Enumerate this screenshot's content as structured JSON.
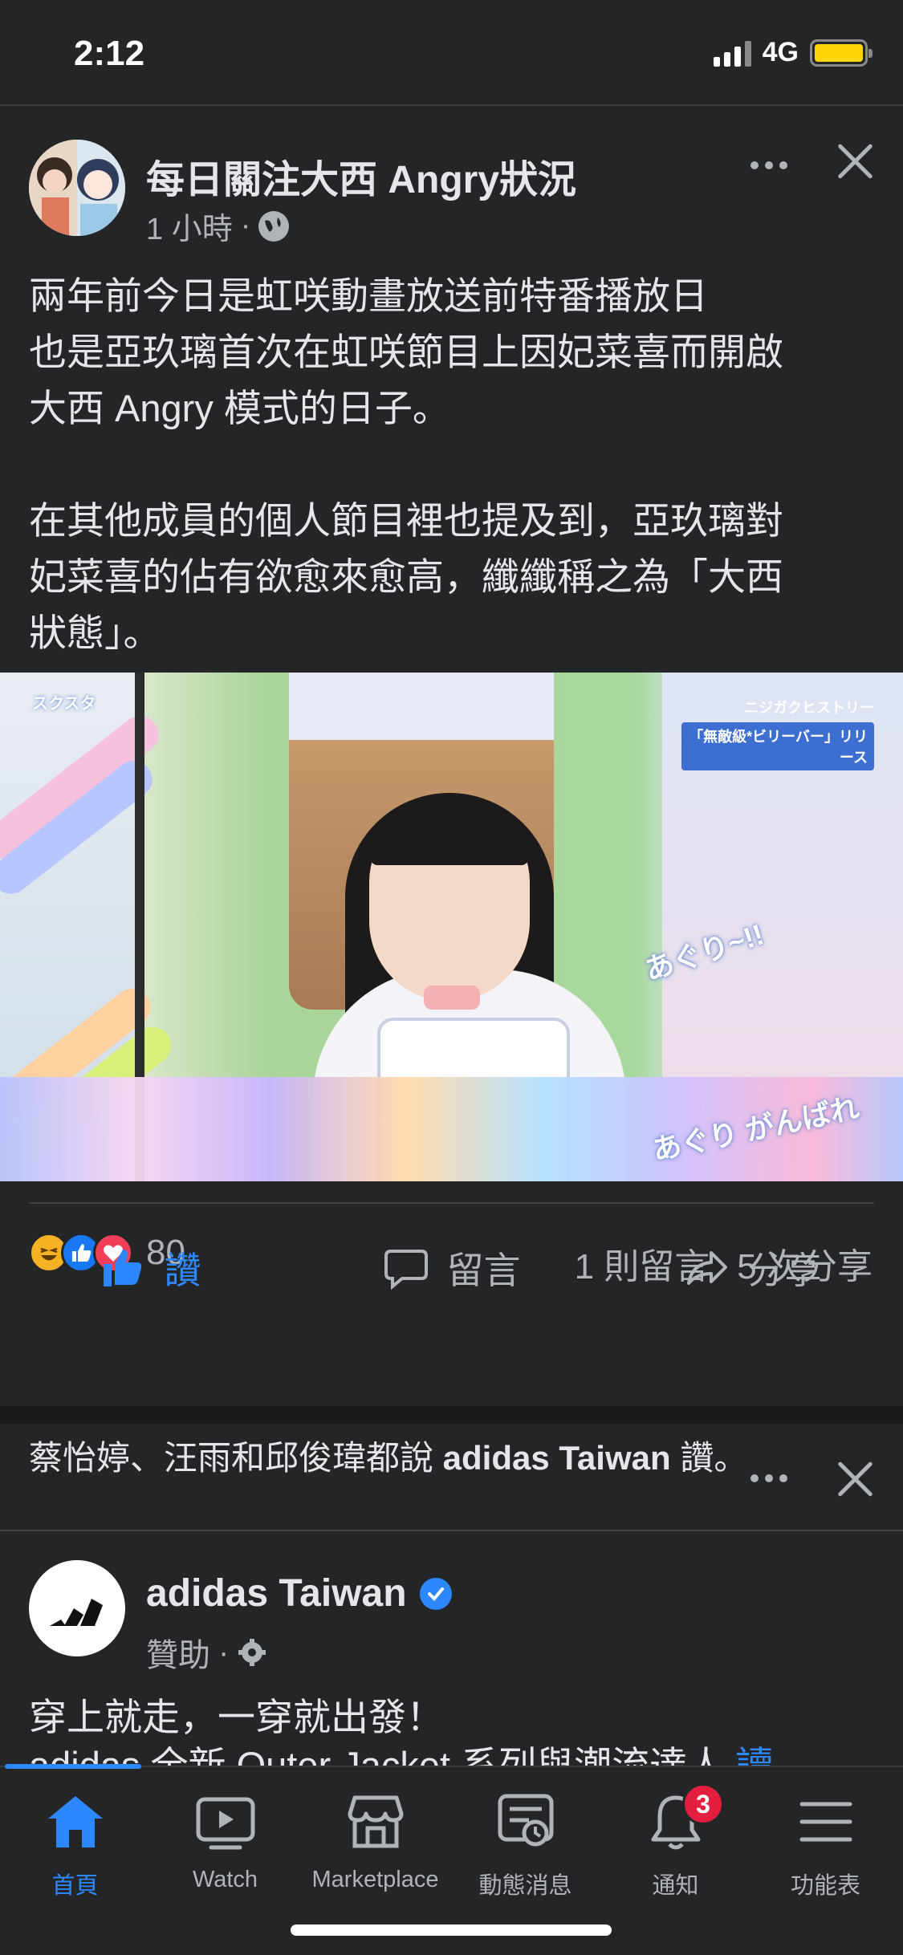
{
  "status_bar": {
    "time": "2:12",
    "network": "4G"
  },
  "post": {
    "page_name": "每日關注大西 Angry狀況",
    "time": "1 小時",
    "separator": "·",
    "text_lines": [
      "兩年前今日是虹咲動畫放送前特番播放日",
      "也是亞玖璃首次在虹咲節目上因妃菜喜而開啟",
      "大西 Angry 模式的日子。"
    ],
    "text_lines_2": [
      "在其他成員的個人節目裡也提及到，亞玖璃對",
      "妃菜喜的佔有欲愈來愈高，纖纖稱之為「大西",
      "狀態」。"
    ],
    "photo": {
      "overlay_1": "あぐり~!!",
      "overlay_2": "あぐり がんばれ",
      "logo_left": "スクスタ",
      "logo_right_top": "ニジガクヒストリー",
      "logo_right_bar": "「無敵級*ビリーバー」リリース"
    },
    "reactions": {
      "icons": [
        "haha-icon",
        "like-icon",
        "love-icon"
      ],
      "count": "80"
    },
    "comments": "1 則留言",
    "shares": "5 次分享",
    "actions": {
      "like": "讚",
      "comment": "留言",
      "share": "分享"
    }
  },
  "ad": {
    "social_context_prefix": "蔡怡婷、汪雨和邱俊瑋都說 ",
    "social_context_page": "adidas Taiwan",
    "social_context_suffix": " 讚。",
    "name": "adidas Taiwan",
    "sponsored": "贊助",
    "separator": "·",
    "text": "穿上就走，一穿就出發！",
    "text2": "adidas 全新 Outer Jacket 系列與潮流達人",
    "more": "讀"
  },
  "tabbar": {
    "home": "首頁",
    "watch": "Watch",
    "marketplace": "Marketplace",
    "news": "動態消息",
    "notifications": "通知",
    "notifications_badge": "3",
    "menu": "功能表"
  },
  "colors": {
    "accent": "#2d88ff",
    "background": "#242526",
    "badge": "#e41e3f"
  }
}
